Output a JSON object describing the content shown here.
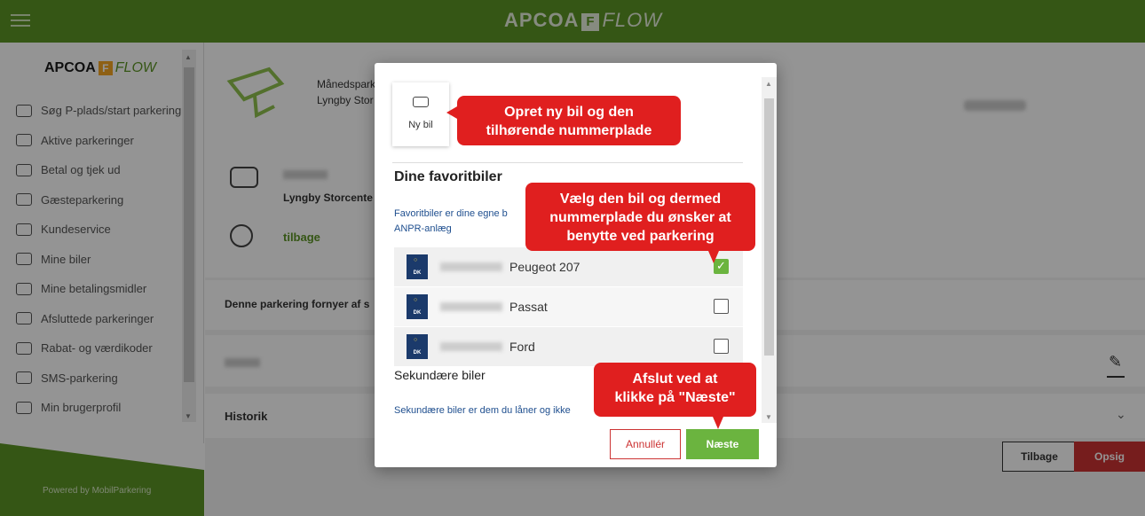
{
  "topbar": {
    "logo_main": "APCOA",
    "logo_f": "F",
    "logo_flow": "FLOW"
  },
  "sidebar": {
    "logo_main": "APCOA",
    "logo_f": "F",
    "logo_flow": "FLOW",
    "items": [
      {
        "label": "Søg P-plads/start parkering",
        "icon": "parking-search-icon"
      },
      {
        "label": "Aktive parkeringer",
        "icon": "stopwatch-icon"
      },
      {
        "label": "Betal og tjek ud",
        "icon": "car-pay-icon"
      },
      {
        "label": "Gæsteparkering",
        "icon": "guest-icon"
      },
      {
        "label": "Kundeservice",
        "icon": "support-icon"
      },
      {
        "label": "Mine biler",
        "icon": "car-icon"
      },
      {
        "label": "Mine betalingsmidler",
        "icon": "card-icon"
      },
      {
        "label": "Afsluttede parkeringer",
        "icon": "parking-done-icon"
      },
      {
        "label": "Rabat- og værdikoder",
        "icon": "discount-icon"
      },
      {
        "label": "SMS-parkering",
        "icon": "sms-icon"
      },
      {
        "label": "Min brugerprofil",
        "icon": "profile-icon"
      }
    ],
    "powered_by": "Powered by MobilParkering"
  },
  "main": {
    "monthly_line1": "Månedspark",
    "monthly_line2": "Lyngby Stor",
    "location": "Lyngby Storcente",
    "back_link": "tilbage",
    "renew_text": "Denne parkering fornyer af s",
    "history": "Historik",
    "btn_back": "Tilbage",
    "btn_cancel": "Opsig"
  },
  "modal": {
    "new_car": "Ny bil",
    "fav_title": "Dine favoritbiler",
    "fav_desc_line1": "Favoritbiler er dine egne b",
    "fav_desc_line2": "ANPR-anlæg",
    "plate_country": "DK",
    "cars": [
      {
        "name": "Peugeot 207",
        "checked": true
      },
      {
        "name": "Passat",
        "checked": false
      },
      {
        "name": "Ford",
        "checked": false
      }
    ],
    "checkmark": "✓",
    "secondary_title": "Sekundære biler",
    "secondary_desc": "Sekundære biler er dem du låner og ikke",
    "btn_cancel": "Annullér",
    "btn_next": "Næste"
  },
  "callouts": {
    "new_car_line1": "Opret ny bil og den",
    "new_car_line2": "tilhørende nummerplade",
    "select_line1": "Vælg den bil og dermed",
    "select_line2": "nummerplade du ønsker at",
    "select_line3": "benytte ved parkering",
    "finish_line1": "Afslut ved at",
    "finish_line2": "klikke på \"Næste\""
  },
  "colors": {
    "brand_green": "#5c9425",
    "accent_red": "#e01f1f",
    "check_green": "#6bb43f",
    "plate_blue": "#1b3a6b"
  }
}
